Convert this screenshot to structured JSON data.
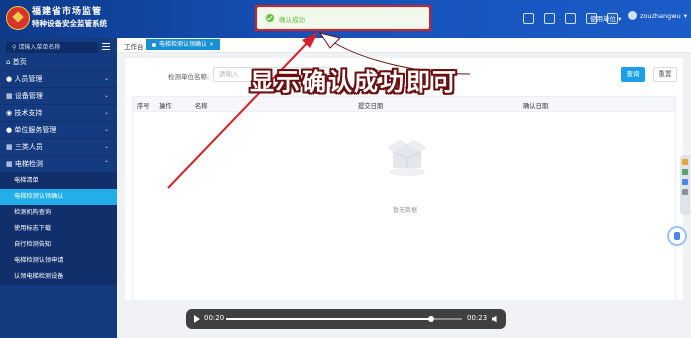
{
  "header": {
    "title_line1": "福建省市场监管",
    "title_line2": "特种设备安全监管系统",
    "unit_label": "使用单位",
    "user_name": "zouzhangwu"
  },
  "sidebar": {
    "search_placeholder": "请输入菜单名称",
    "items": [
      {
        "label": "首页"
      },
      {
        "label": "人员管理"
      },
      {
        "label": "设备管理"
      },
      {
        "label": "技术支持"
      },
      {
        "label": "单位服务管理"
      },
      {
        "label": "三类人员"
      },
      {
        "label": "电梯检测"
      }
    ],
    "sub_items": [
      {
        "label": "电梯清单"
      },
      {
        "label": "电梯检测认领确认"
      },
      {
        "label": "检测机构查询"
      },
      {
        "label": "使用标志下载"
      },
      {
        "label": "自行检测告知"
      },
      {
        "label": "电梯检测认领申请"
      },
      {
        "label": "认领电梯检测设备"
      }
    ]
  },
  "tabs": {
    "home": "工作台",
    "active": "电梯检测认领确认"
  },
  "query": {
    "label": "检测单位名称:",
    "placeholder": "请输入",
    "search_button": "查询",
    "reset_button": "重置"
  },
  "table": {
    "columns": [
      "序号",
      "操作",
      "名称",
      "提交日期",
      "确认日期"
    ],
    "empty_text": "暂无数据"
  },
  "toast": {
    "message": "确认成功"
  },
  "annotation": "显示确认成功即可",
  "player": {
    "current": "00:20",
    "duration": "00:23",
    "progress": 0.87
  },
  "colors": {
    "header": "#1651b8",
    "sidebar": "#143a80",
    "accent": "#22aee8",
    "success": "#67c23a",
    "highlight": "#d6202a"
  }
}
